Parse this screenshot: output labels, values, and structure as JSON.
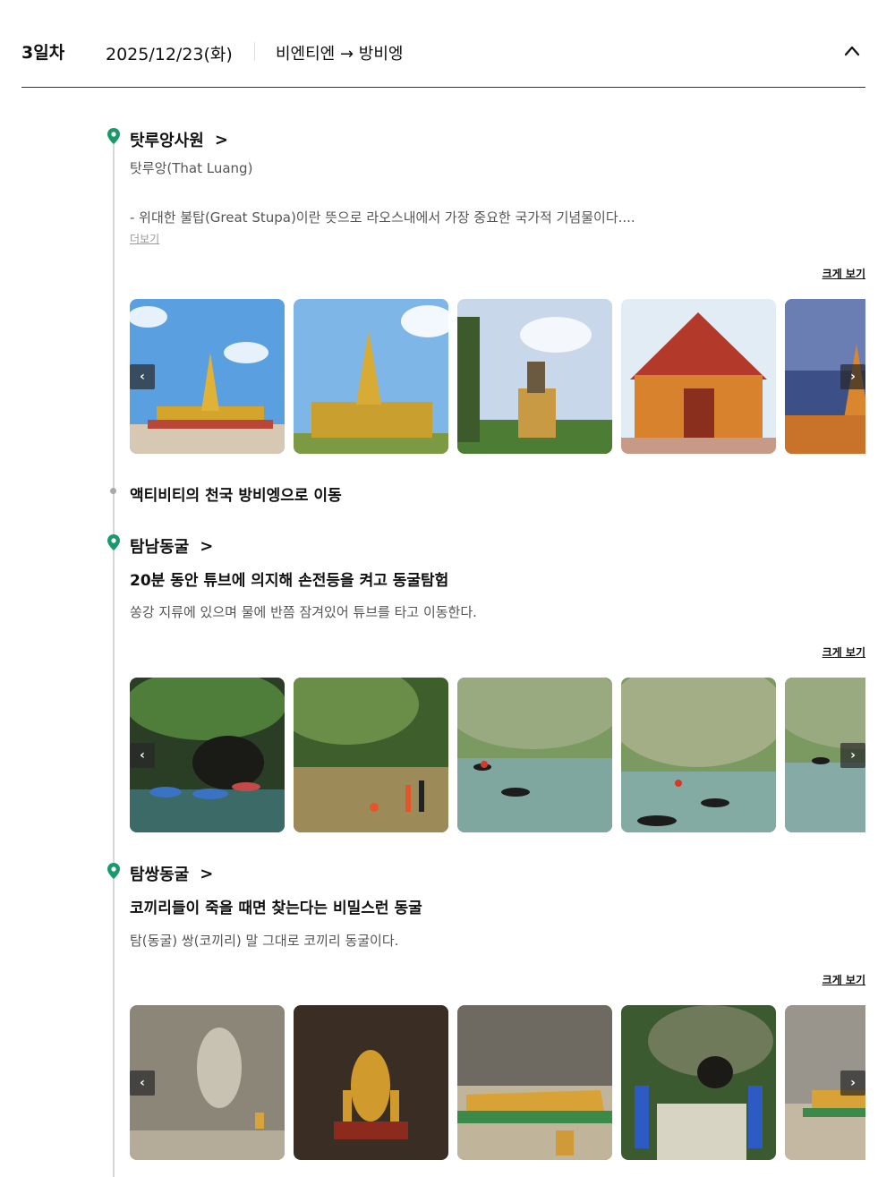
{
  "day": {
    "label": "3일차",
    "date": "2025/12/23(화)",
    "route": "비엔티엔 → 방비엥",
    "collapse_icon": "chevron-up-icon"
  },
  "colors": {
    "pin": "#1a9a6c",
    "timeline": "#d8d8d8"
  },
  "stops": [
    {
      "title": "탓루앙사원",
      "subtitle": "탓루앙(That Luang)",
      "desc": "- 위대한 불탑(Great Stupa)이란 뜻으로 라오스내에서 가장 중요한 국가적 기념물이다....",
      "more": "더보기",
      "big_view": "크게 보기"
    },
    {
      "move": "액티비티의 천국 방비엥으로 이동"
    },
    {
      "title": "탐남동굴",
      "headline": "20분 동안 튜브에 의지해 손전등을 켜고 동굴탐험",
      "desc": "쏭강 지류에 있으며 물에 반쯤 잠겨있어 튜브를 타고 이동한다.",
      "big_view": "크게 보기"
    },
    {
      "title": "탐쌍동굴",
      "headline": "코끼리들이 죽을 때면 찾는다는 비밀스런 동굴",
      "desc": "탐(동굴) 쌍(코끼리) 말 그대로 코끼리 동굴이다.",
      "big_view": "크게 보기"
    }
  ],
  "nav": {
    "prev": "‹",
    "next": "›"
  }
}
